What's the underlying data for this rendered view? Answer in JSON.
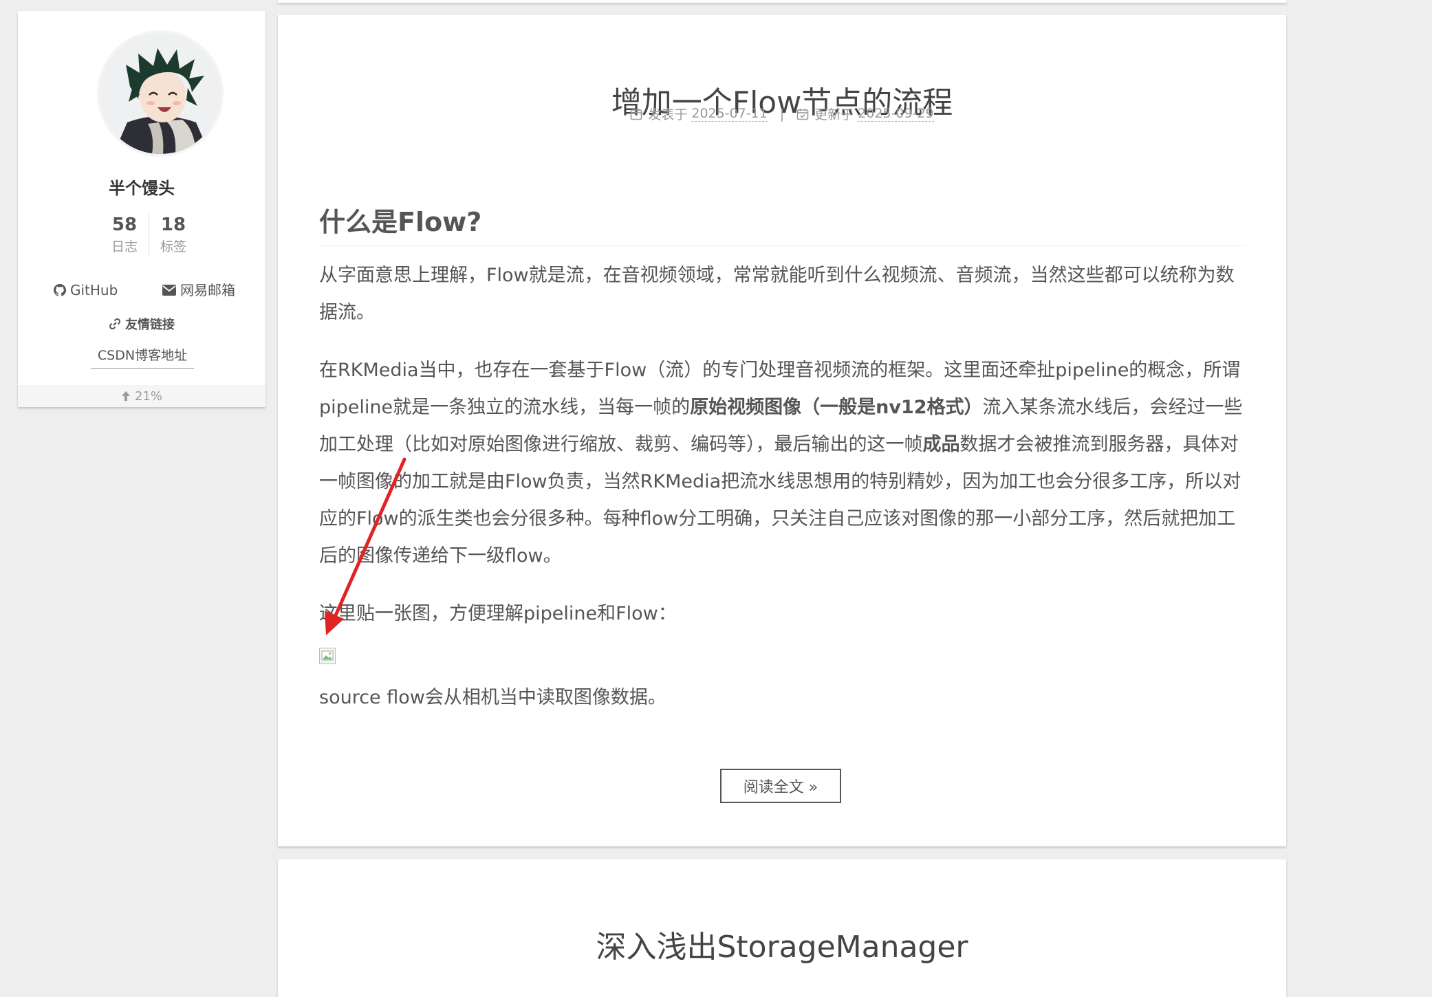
{
  "sidebar": {
    "author_name": "半个馒头",
    "stats": [
      {
        "count": "58",
        "label": "日志"
      },
      {
        "count": "18",
        "label": "标签"
      }
    ],
    "links": [
      {
        "label": "GitHub",
        "icon": "github-icon"
      },
      {
        "label": "网易邮箱",
        "icon": "envelope-icon"
      }
    ],
    "friend_links_title": "友情链接",
    "friend_link": "CSDN博客地址",
    "scroll_percent": "21%"
  },
  "posts": [
    {
      "title": "增加一个Flow节点的流程",
      "published_label": "发表于",
      "published_date": "2025-07-11",
      "meta_divider": "|",
      "updated_label": "更新于",
      "updated_date": "2025-09-29",
      "heading": "什么是Flow?",
      "p1": "从字面意思上理解，Flow就是流，在音视频领域，常常就能听到什么视频流、音频流，当然这些都可以统称为数据流。",
      "p2_part1": "在RKMedia当中，也存在一套基于Flow（流）的专门处理音视频流的框架。这里面还牵扯pipeline的概念，所谓pipeline就是一条独立的流水线，当每一帧的",
      "p2_bold1": "原始视频图像（一般是nv12格式）",
      "p2_part2": "流入某条流水线后，会经过一些加工处理（比如对原始图像进行缩放、裁剪、编码等），最后输出的这一帧",
      "p2_bold2": "成品",
      "p2_part3": "数据才会被推流到服务器，具体对一帧图像的加工就是由Flow负责，当然RKMedia把流水线思想用的特别精妙，因为加工也会分很多工序，所以对应的Flow的派生类也会分很多种。每种flow分工明确，只关注自己应该对图像的那一小部分工序，然后就把加工后的图像传递给下一级flow。",
      "p3": "这里贴一张图，方便理解pipeline和Flow：",
      "p4": "source flow会从相机当中读取图像数据。",
      "read_more": "阅读全文 »"
    },
    {
      "title": "深入浅出StorageManager"
    }
  ],
  "colors": {
    "background": "#eeeeee",
    "card": "#ffffff",
    "text": "#555555",
    "annotation_arrow": "#e02424"
  }
}
